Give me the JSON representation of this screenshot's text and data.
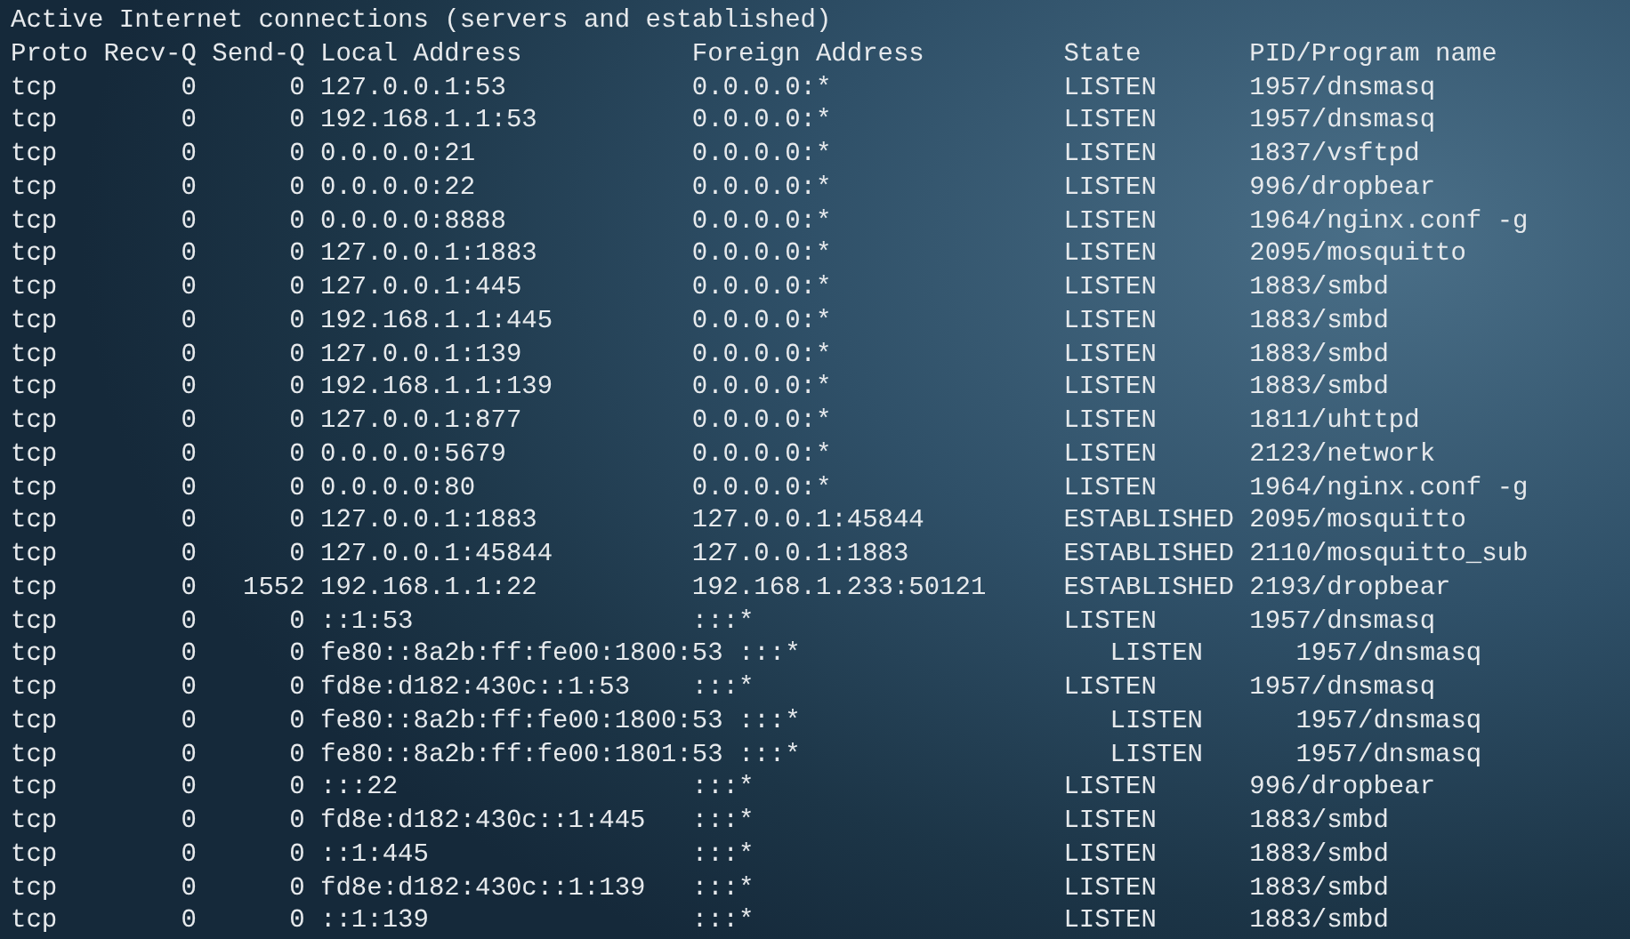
{
  "terminal": {
    "title": "Active Internet connections (servers and established)",
    "columns": [
      "Proto",
      "Recv-Q",
      "Send-Q",
      "Local Address",
      "Foreign Address",
      "State",
      "PID/Program name"
    ],
    "rows": [
      {
        "proto": "tcp",
        "recv_q": "0",
        "send_q": "0",
        "local": "127.0.0.1:53",
        "foreign": "0.0.0.0:*",
        "state": "LISTEN",
        "program": "1957/dnsmasq"
      },
      {
        "proto": "tcp",
        "recv_q": "0",
        "send_q": "0",
        "local": "192.168.1.1:53",
        "foreign": "0.0.0.0:*",
        "state": "LISTEN",
        "program": "1957/dnsmasq"
      },
      {
        "proto": "tcp",
        "recv_q": "0",
        "send_q": "0",
        "local": "0.0.0.0:21",
        "foreign": "0.0.0.0:*",
        "state": "LISTEN",
        "program": "1837/vsftpd"
      },
      {
        "proto": "tcp",
        "recv_q": "0",
        "send_q": "0",
        "local": "0.0.0.0:22",
        "foreign": "0.0.0.0:*",
        "state": "LISTEN",
        "program": "996/dropbear"
      },
      {
        "proto": "tcp",
        "recv_q": "0",
        "send_q": "0",
        "local": "0.0.0.0:8888",
        "foreign": "0.0.0.0:*",
        "state": "LISTEN",
        "program": "1964/nginx.conf -g"
      },
      {
        "proto": "tcp",
        "recv_q": "0",
        "send_q": "0",
        "local": "127.0.0.1:1883",
        "foreign": "0.0.0.0:*",
        "state": "LISTEN",
        "program": "2095/mosquitto"
      },
      {
        "proto": "tcp",
        "recv_q": "0",
        "send_q": "0",
        "local": "127.0.0.1:445",
        "foreign": "0.0.0.0:*",
        "state": "LISTEN",
        "program": "1883/smbd"
      },
      {
        "proto": "tcp",
        "recv_q": "0",
        "send_q": "0",
        "local": "192.168.1.1:445",
        "foreign": "0.0.0.0:*",
        "state": "LISTEN",
        "program": "1883/smbd"
      },
      {
        "proto": "tcp",
        "recv_q": "0",
        "send_q": "0",
        "local": "127.0.0.1:139",
        "foreign": "0.0.0.0:*",
        "state": "LISTEN",
        "program": "1883/smbd"
      },
      {
        "proto": "tcp",
        "recv_q": "0",
        "send_q": "0",
        "local": "192.168.1.1:139",
        "foreign": "0.0.0.0:*",
        "state": "LISTEN",
        "program": "1883/smbd"
      },
      {
        "proto": "tcp",
        "recv_q": "0",
        "send_q": "0",
        "local": "127.0.0.1:877",
        "foreign": "0.0.0.0:*",
        "state": "LISTEN",
        "program": "1811/uhttpd"
      },
      {
        "proto": "tcp",
        "recv_q": "0",
        "send_q": "0",
        "local": "0.0.0.0:5679",
        "foreign": "0.0.0.0:*",
        "state": "LISTEN",
        "program": "2123/network"
      },
      {
        "proto": "tcp",
        "recv_q": "0",
        "send_q": "0",
        "local": "0.0.0.0:80",
        "foreign": "0.0.0.0:*",
        "state": "LISTEN",
        "program": "1964/nginx.conf -g"
      },
      {
        "proto": "tcp",
        "recv_q": "0",
        "send_q": "0",
        "local": "127.0.0.1:1883",
        "foreign": "127.0.0.1:45844",
        "state": "ESTABLISHED",
        "program": "2095/mosquitto"
      },
      {
        "proto": "tcp",
        "recv_q": "0",
        "send_q": "0",
        "local": "127.0.0.1:45844",
        "foreign": "127.0.0.1:1883",
        "state": "ESTABLISHED",
        "program": "2110/mosquitto_sub"
      },
      {
        "proto": "tcp",
        "recv_q": "0",
        "send_q": "1552",
        "local": "192.168.1.1:22",
        "foreign": "192.168.1.233:50121",
        "state": "ESTABLISHED",
        "program": "2193/dropbear"
      },
      {
        "proto": "tcp",
        "recv_q": "0",
        "send_q": "0",
        "local": "::1:53",
        "foreign": ":::*",
        "state": "LISTEN",
        "program": "1957/dnsmasq"
      },
      {
        "proto": "tcp",
        "recv_q": "0",
        "send_q": "0",
        "local": "fe80::8a2b:ff:fe00:1800:53",
        "foreign": ":::*",
        "state": "LISTEN",
        "program": "1957/dnsmasq"
      },
      {
        "proto": "tcp",
        "recv_q": "0",
        "send_q": "0",
        "local": "fd8e:d182:430c::1:53",
        "foreign": ":::*",
        "state": "LISTEN",
        "program": "1957/dnsmasq"
      },
      {
        "proto": "tcp",
        "recv_q": "0",
        "send_q": "0",
        "local": "fe80::8a2b:ff:fe00:1800:53",
        "foreign": ":::*",
        "state": "LISTEN",
        "program": "1957/dnsmasq"
      },
      {
        "proto": "tcp",
        "recv_q": "0",
        "send_q": "0",
        "local": "fe80::8a2b:ff:fe00:1801:53",
        "foreign": ":::*",
        "state": "LISTEN",
        "program": "1957/dnsmasq"
      },
      {
        "proto": "tcp",
        "recv_q": "0",
        "send_q": "0",
        "local": ":::22",
        "foreign": ":::*",
        "state": "LISTEN",
        "program": "996/dropbear"
      },
      {
        "proto": "tcp",
        "recv_q": "0",
        "send_q": "0",
        "local": "fd8e:d182:430c::1:445",
        "foreign": ":::*",
        "state": "LISTEN",
        "program": "1883/smbd"
      },
      {
        "proto": "tcp",
        "recv_q": "0",
        "send_q": "0",
        "local": "::1:445",
        "foreign": ":::*",
        "state": "LISTEN",
        "program": "1883/smbd"
      },
      {
        "proto": "tcp",
        "recv_q": "0",
        "send_q": "0",
        "local": "fd8e:d182:430c::1:139",
        "foreign": ":::*",
        "state": "LISTEN",
        "program": "1883/smbd"
      },
      {
        "proto": "tcp",
        "recv_q": "0",
        "send_q": "0",
        "local": "::1:139",
        "foreign": ":::*",
        "state": "LISTEN",
        "program": "1883/smbd"
      }
    ]
  }
}
